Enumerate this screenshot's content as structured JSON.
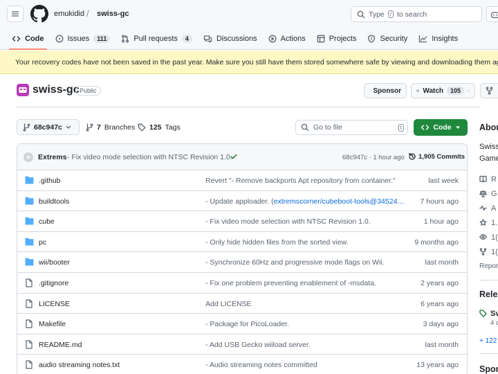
{
  "header": {
    "owner": "emukidid",
    "separator": "/",
    "repo": "swiss-gc",
    "search_prefix": "Type",
    "search_key": "/",
    "search_suffix": "to search"
  },
  "nav": {
    "tabs": [
      {
        "label": "Code",
        "icon": "code-icon",
        "count": null
      },
      {
        "label": "Issues",
        "icon": "issue-icon",
        "count": "111"
      },
      {
        "label": "Pull requests",
        "icon": "pull-request-icon",
        "count": "4"
      },
      {
        "label": "Discussions",
        "icon": "discussions-icon",
        "count": null
      },
      {
        "label": "Actions",
        "icon": "play-icon",
        "count": null
      },
      {
        "label": "Projects",
        "icon": "table-icon",
        "count": null
      },
      {
        "label": "Security",
        "icon": "shield-icon",
        "count": null
      },
      {
        "label": "Insights",
        "icon": "graph-icon",
        "count": null
      }
    ]
  },
  "banner": {
    "text": "Your recovery codes have not been saved in the past year. Make sure you still have them stored somewhere safe by viewing and downloading them again."
  },
  "repo": {
    "name": "swiss-gc",
    "visibility": "Public",
    "sponsor_label": "Sponsor",
    "watch_label": "Watch",
    "watch_count": "105"
  },
  "filenav": {
    "branch": "68c947c",
    "branches_count": "7",
    "branches_label": "Branches",
    "tags_count": "125",
    "tags_label": "Tags",
    "goto_placeholder": "Go to file",
    "goto_key": "t",
    "code_label": "Code"
  },
  "commit": {
    "author": "Extrems",
    "message": "- Fix video mode selection with NTSC Revision 1.0.",
    "hash_time": "68c947c · 1 hour ago",
    "commits_label": "1,905 Commits"
  },
  "files": [
    {
      "type": "dir",
      "name": ".github",
      "message": "Revert \"- Remove backports Apt repository from container.\"",
      "link": "",
      "date": "last week"
    },
    {
      "type": "dir",
      "name": "buildtools",
      "message": "- Update apploader. (",
      "link": "extremscorner/cubeboot-tools@34524…",
      "date": "7 hours ago"
    },
    {
      "type": "dir",
      "name": "cube",
      "message": "- Fix video mode selection with NTSC Revision 1.0.",
      "link": "",
      "date": "1 hour ago"
    },
    {
      "type": "dir",
      "name": "pc",
      "message": "- Only hide hidden files from the sorted view.",
      "link": "",
      "date": "9 months ago"
    },
    {
      "type": "dir",
      "name": "wii/booter",
      "message": "- Synchronize 60Hz and progressive mode flags on Wii.",
      "link": "",
      "date": "last month"
    },
    {
      "type": "file",
      "name": ".gitignore",
      "message": "- Fix one problem preventing enablement of -msdata.",
      "link": "",
      "date": "2 years ago"
    },
    {
      "type": "file",
      "name": "LICENSE",
      "message": "Add LICENSE",
      "link": "",
      "date": "6 years ago"
    },
    {
      "type": "file",
      "name": "Makefile",
      "message": "- Package for PicoLoader.",
      "link": "",
      "date": "3 days ago"
    },
    {
      "type": "file",
      "name": "README.md",
      "message": "- Add USB Gecko wiiload server.",
      "link": "",
      "date": "last month"
    },
    {
      "type": "file",
      "name": "audio streaming notes.txt",
      "message": "- Audio streaming notes committed",
      "link": "",
      "date": "13 years ago"
    }
  ],
  "sidebar": {
    "about": "Abou",
    "desc1": "Swiss",
    "desc2": "Game",
    "r1": "R",
    "r2": "G",
    "r3": "A",
    "r4": "1.",
    "r5": "1(",
    "r6": "1(",
    "report": "Repor",
    "releases": "Relea",
    "rel_name": "Sv",
    "rel_sub": "4 c",
    "more": "+ 122",
    "sponsors": "Spon"
  }
}
